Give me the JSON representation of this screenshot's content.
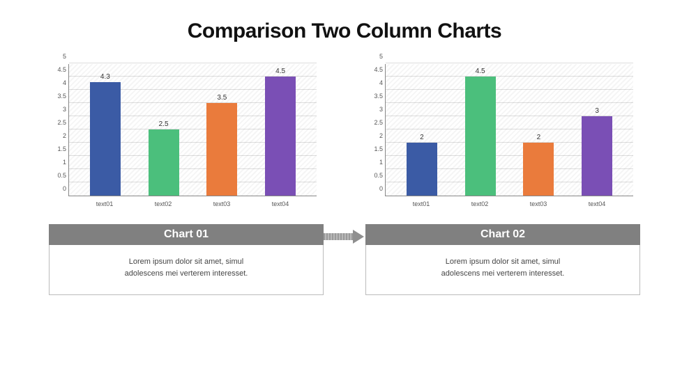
{
  "title": "Comparison Two Column Charts",
  "colors": [
    "#3b5ba5",
    "#4bbf7c",
    "#ea7b3c",
    "#7a4fb5"
  ],
  "y_ticks": [
    "0",
    "0.5",
    "1",
    "1.5",
    "2",
    "2.5",
    "3",
    "3.5",
    "4",
    "4.5",
    "5"
  ],
  "chart_data": [
    {
      "type": "bar",
      "title": "",
      "categories": [
        "text01",
        "text02",
        "text03",
        "text04"
      ],
      "values": [
        4.3,
        2.5,
        3.5,
        4.5
      ],
      "xlabel": "",
      "ylabel": "",
      "ylim": [
        0,
        5
      ]
    },
    {
      "type": "bar",
      "title": "",
      "categories": [
        "text01",
        "text02",
        "text03",
        "text04"
      ],
      "values": [
        2,
        4.5,
        2,
        3
      ],
      "xlabel": "",
      "ylabel": "",
      "ylim": [
        0,
        5
      ]
    }
  ],
  "captions": [
    {
      "header": "Chart 01",
      "body_line1": "Lorem ipsum dolor sit amet, simul",
      "body_line2": "adolescens mei verterem interesset."
    },
    {
      "header": "Chart 02",
      "body_line1": "Lorem ipsum dolor sit amet, simul",
      "body_line2": "adolescens mei verterem interesset."
    }
  ]
}
